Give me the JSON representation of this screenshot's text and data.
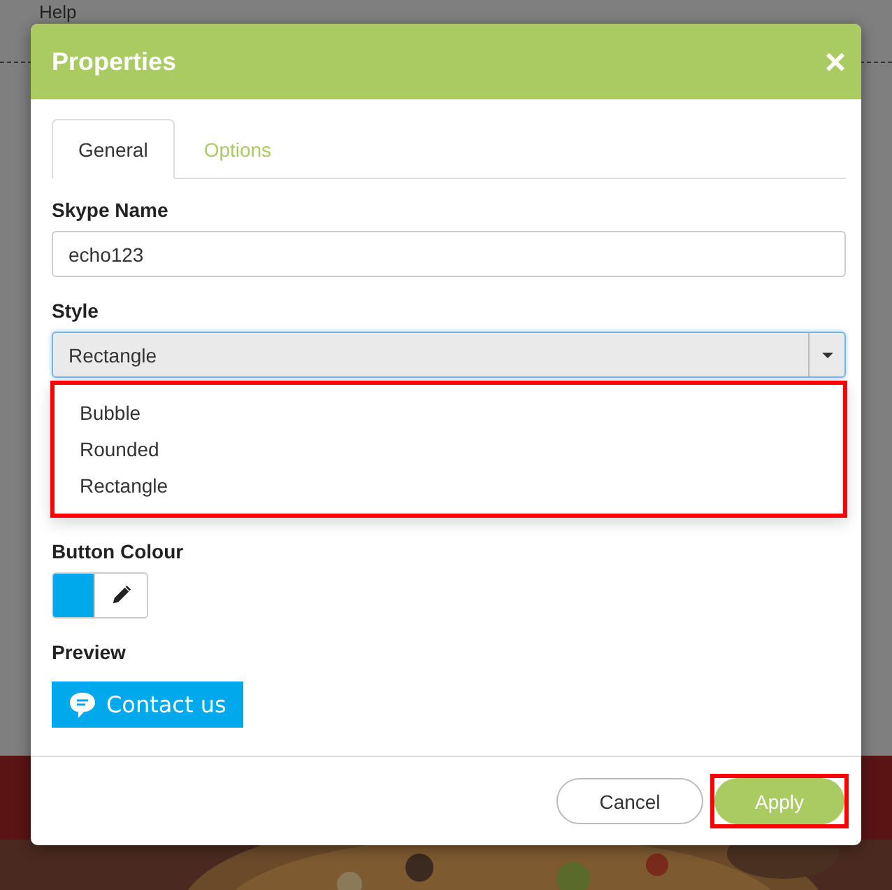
{
  "background": {
    "menu_label": "Help"
  },
  "dialog": {
    "title": "Properties",
    "close_label": "×",
    "tabs": [
      {
        "label": "General",
        "selected": true
      },
      {
        "label": "Options",
        "selected": false
      }
    ],
    "fields": [
      {
        "kind": "text",
        "label": "Skype Name",
        "value": "echo123"
      },
      {
        "kind": "select",
        "label": "Style",
        "value": "Rectangle",
        "open": true,
        "highlighted": true,
        "options": [
          {
            "label": "Bubble"
          },
          {
            "label": "Rounded"
          },
          {
            "label": "Rectangle"
          }
        ]
      },
      {
        "kind": "colour",
        "label": "Button Colour",
        "color": "#00a8ec"
      },
      {
        "kind": "preview",
        "label": "Preview",
        "button_text": "Contact us"
      }
    ],
    "buttons": [
      {
        "label": "Cancel",
        "kind": "secondary",
        "highlighted": false
      },
      {
        "label": "Apply",
        "kind": "primary",
        "highlighted": true
      }
    ]
  }
}
